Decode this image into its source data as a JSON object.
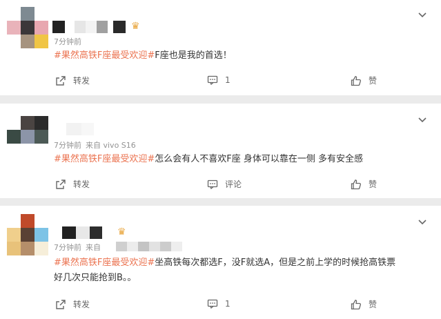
{
  "colors": {
    "topic": "#eb7350",
    "muted": "#939393",
    "crown": "#e8a43a",
    "background": "#ebebeb"
  },
  "posts": [
    {
      "time": "7分钟前",
      "source": "",
      "topic": "#果然高铁F座最受欢迎#",
      "body": "F座也是我的首选！",
      "share_label": "转发",
      "comment_label": "1",
      "like_label": "赞",
      "has_crown": true
    },
    {
      "time": "7分钟前",
      "source": "来自 vivo S16",
      "topic": "#果然高铁F座最受欢迎#",
      "body": "怎么会有人不喜欢F座 身体可以靠在一侧 多有安全感",
      "share_label": "转发",
      "comment_label": "评论",
      "like_label": "赞",
      "has_crown": false
    },
    {
      "time": "7分钟前",
      "source": "来自",
      "topic": "#果然高铁F座最受欢迎#",
      "body_line1": "坐高铁每次都选F，没F就选A，但是之前上学的时候抢高铁票",
      "body_line2": "好几次只能抢到B。。",
      "share_label": "转发",
      "comment_label": "1",
      "like_label": "赞",
      "has_crown": true
    }
  ],
  "icons": {
    "share": "share-icon",
    "comment": "comment-icon",
    "like": "thumbs-up-icon",
    "menu": "chevron-down-icon",
    "badge": "crown-icon"
  }
}
